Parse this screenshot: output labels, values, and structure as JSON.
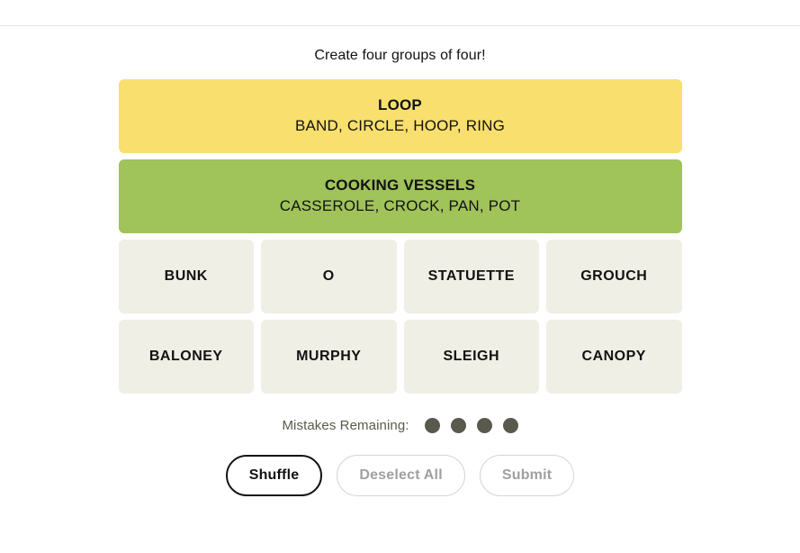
{
  "header": {
    "divider": true
  },
  "instructions": "Create four groups of four!",
  "colors": {
    "yellow": "#f9df6d",
    "green": "#a0c35a",
    "tile": "#efefe6",
    "dot": "#5a594e",
    "text": "#121212",
    "muted": "#a0a0a0"
  },
  "solved_groups": [
    {
      "title": "LOOP",
      "members": "BAND, CIRCLE, HOOP, RING",
      "color": "#f9df6d",
      "color_name": "yellow"
    },
    {
      "title": "COOKING VESSELS",
      "members": "CASSEROLE, CROCK, PAN, POT",
      "color": "#a0c35a",
      "color_name": "green"
    }
  ],
  "tile_rows": [
    [
      {
        "label": "BUNK",
        "selected": false
      },
      {
        "label": "O",
        "selected": false
      },
      {
        "label": "STATUETTE",
        "selected": false
      },
      {
        "label": "GROUCH",
        "selected": false
      }
    ],
    [
      {
        "label": "BALONEY",
        "selected": false
      },
      {
        "label": "MURPHY",
        "selected": false
      },
      {
        "label": "SLEIGH",
        "selected": false
      },
      {
        "label": "CANOPY",
        "selected": false
      }
    ]
  ],
  "mistakes": {
    "label": "Mistakes Remaining:",
    "remaining": 4
  },
  "controls": [
    {
      "label": "Shuffle",
      "state": "enabled",
      "name": "shuffle-button"
    },
    {
      "label": "Deselect All",
      "state": "disabled",
      "name": "deselect-all-button"
    },
    {
      "label": "Submit",
      "state": "disabled",
      "name": "submit-button"
    }
  ]
}
